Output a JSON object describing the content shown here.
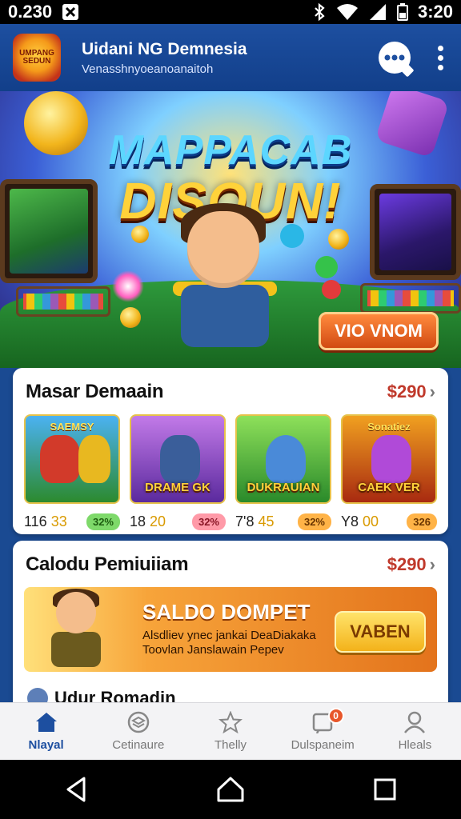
{
  "status_bar": {
    "left_text": "0.230",
    "time": "3:20"
  },
  "app_bar": {
    "logo_text": "UMPANG SEDUN",
    "title": "Uidani NG Demnesia",
    "subtitle": "Venasshnyoeanoanaitoh"
  },
  "hero": {
    "title_line1": "MAPPACAB",
    "title_line2": "DISOUN!",
    "cta_label": "VIO VNOM"
  },
  "section1": {
    "title": "Masar Demaain",
    "price": "$290",
    "games": [
      {
        "top_text": "SAEMSY",
        "label": "",
        "num": "116",
        "num_hl": "33",
        "badge": "32%",
        "badge_color": "#7ed96a"
      },
      {
        "top_text": "",
        "label": "DRAME GK",
        "num": "18",
        "num_hl": "20",
        "badge": "32%",
        "badge_color": "#ff9aa8"
      },
      {
        "top_text": "",
        "label": "DUKRAUIAN",
        "num": "7'8",
        "num_hl": "45",
        "badge": "32%",
        "badge_color": "#ffb347"
      },
      {
        "top_text": "Sonatiez",
        "label": "CAEK VER",
        "num": "Y8",
        "num_hl": "00",
        "badge": "326",
        "badge_color": "#ffb347"
      }
    ]
  },
  "section2": {
    "title": "Calodu Pemiuiiam",
    "price": "$290",
    "promo_title": "SALDO DOMPET",
    "promo_desc_line1": "Alsdliev ynec jankai DeaDiakaka",
    "promo_desc_line2": "Toovlan Janslawain Pepev",
    "promo_button": "VABEN",
    "next_label": "Udur Romadin"
  },
  "bottom_nav": {
    "items": [
      {
        "label": "Nlayal",
        "icon": "home-icon"
      },
      {
        "label": "Cetinaure",
        "icon": "shield-icon"
      },
      {
        "label": "Thelly",
        "icon": "star-icon"
      },
      {
        "label": "Dulspaneim",
        "icon": "notification-icon",
        "badge": "0"
      },
      {
        "label": "Hleals",
        "icon": "profile-icon"
      }
    ]
  },
  "colors": {
    "brand": "#1d4fa0",
    "accent": "#f3b21a",
    "price": "#c0392b"
  }
}
